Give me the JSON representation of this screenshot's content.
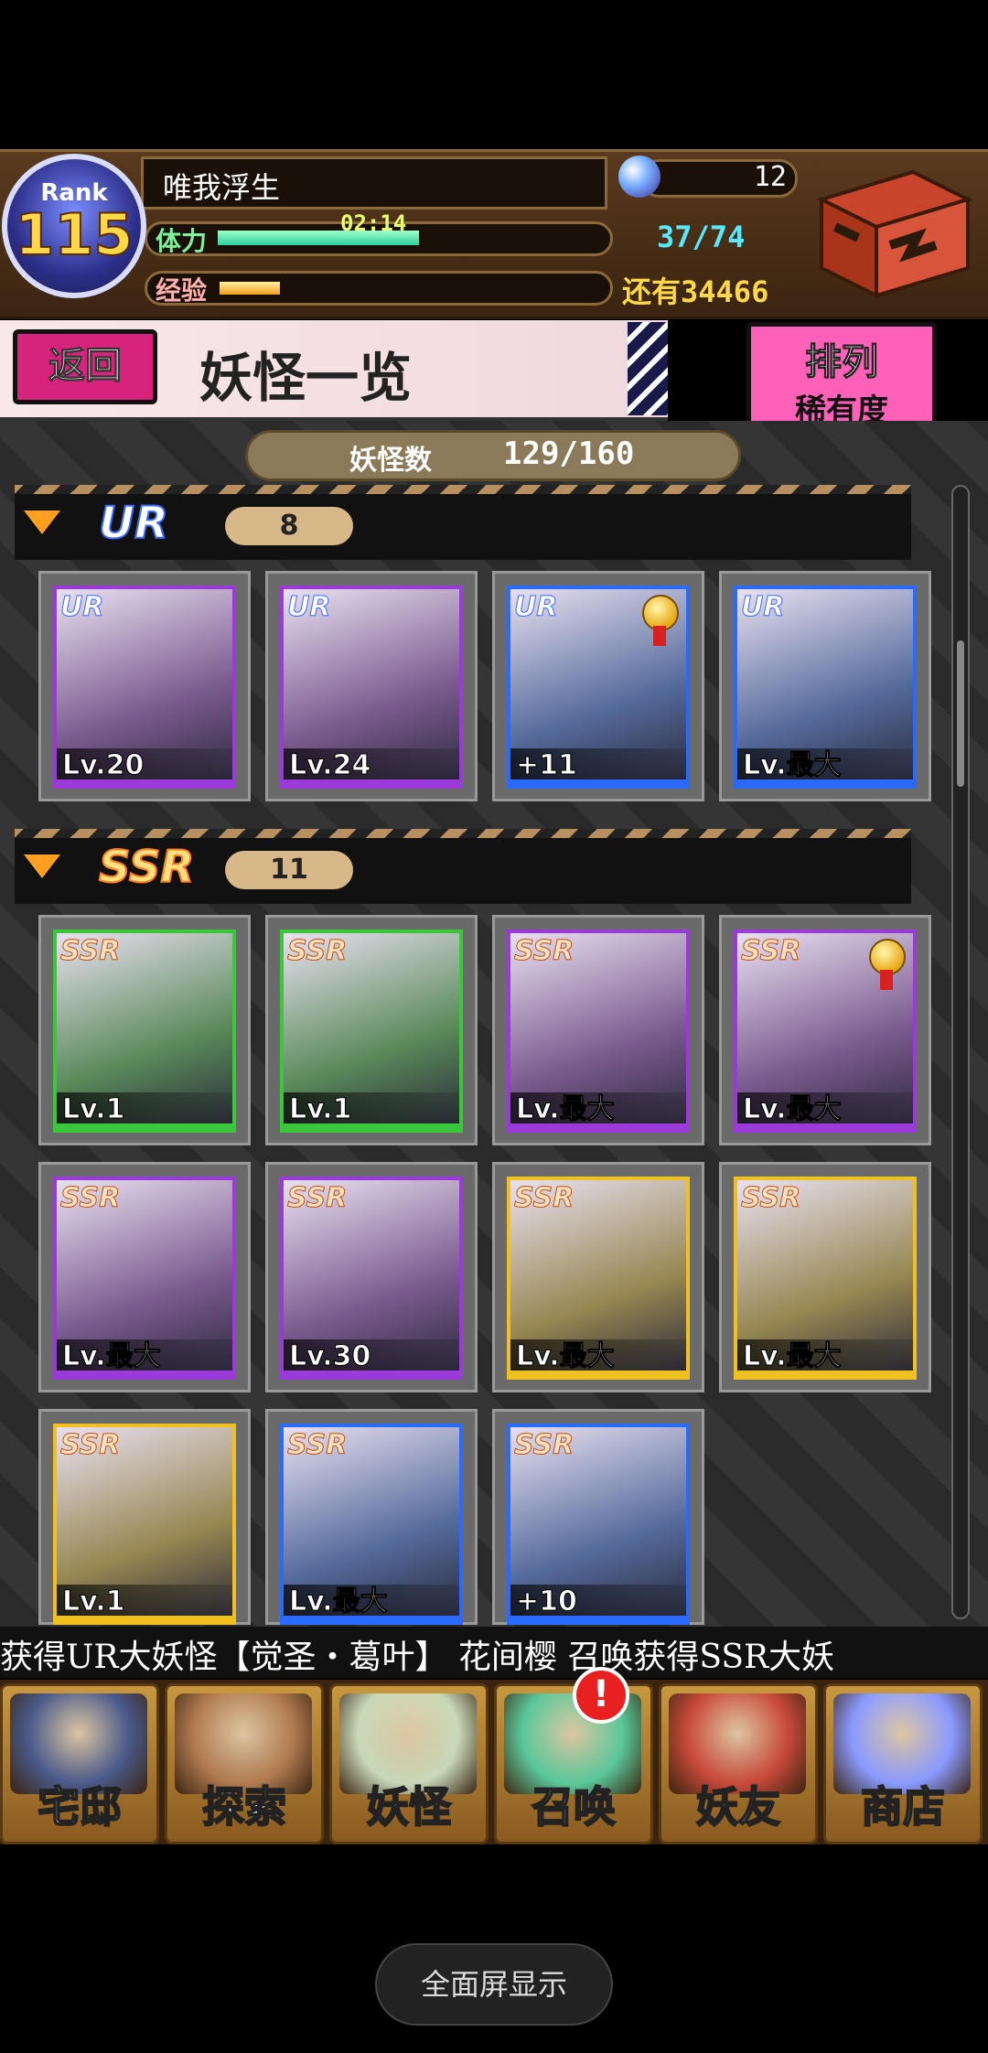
{
  "header": {
    "rank_label": "Rank",
    "rank_value": "115",
    "player_name": "唯我浮生",
    "stamina_label": "体力",
    "stamina_timer": "02:14",
    "stamina_count": "37/74",
    "stamina_fill_fraction": 0.5,
    "exp_label": "经验",
    "exp_fill_fraction": 0.15,
    "exp_remaining": "还有34466",
    "orb_count": "12"
  },
  "title_bar": {
    "back_label": "返回",
    "page_title": "妖怪一览",
    "sort_label": "排列",
    "sort_value": "稀有度"
  },
  "collection": {
    "count_label": "妖怪数",
    "count_value": "129/160"
  },
  "sections": [
    {
      "rarity": "UR",
      "count": "8",
      "cards": [
        {
          "level": "Lv.20",
          "color": "#9b3ad8"
        },
        {
          "level": "Lv.24",
          "color": "#9b3ad8"
        },
        {
          "level": "+11",
          "color": "#2a6aff",
          "medal": true
        },
        {
          "level": "Lv.最大",
          "color": "#2a6aff"
        }
      ]
    },
    {
      "rarity": "SSR",
      "count": "11",
      "cards": [
        {
          "level": "Lv.1",
          "color": "#3ac83a"
        },
        {
          "level": "Lv.1",
          "color": "#3ac83a"
        },
        {
          "level": "Lv.最大",
          "color": "#9b3ad8"
        },
        {
          "level": "Lv.最大",
          "color": "#9b3ad8",
          "medal": true
        },
        {
          "level": "Lv.最大",
          "color": "#9b3ad8"
        },
        {
          "level": "Lv.30",
          "color": "#9b3ad8"
        },
        {
          "level": "Lv.最大",
          "color": "#f0c020"
        },
        {
          "level": "Lv.最大",
          "color": "#f0c020"
        },
        {
          "level": "Lv.1",
          "color": "#f0c020"
        },
        {
          "level": "Lv.最大",
          "color": "#2a6aff"
        },
        {
          "level": "+10",
          "color": "#2a6aff"
        }
      ]
    }
  ],
  "ticker": "获得UR大妖怪【觉圣・葛叶】    花间樱 召唤获得SSR大妖",
  "nav": [
    {
      "label": "宅邸",
      "icon": "house-icon",
      "color": "#4a5a8a"
    },
    {
      "label": "探索",
      "icon": "magnifier-icon",
      "color": "#b07a50"
    },
    {
      "label": "妖怪",
      "icon": "scroll-icon",
      "color": "#c8d8b8"
    },
    {
      "label": "召唤",
      "icon": "pentagram-icon",
      "color": "#5ac89a"
    },
    {
      "label": "妖友",
      "icon": "fox-girl-icon",
      "color": "#c84a3a"
    },
    {
      "label": "商店",
      "icon": "crystal-orb-icon",
      "color": "#8a9aff"
    }
  ],
  "summon_alert": "!",
  "fullscreen_label": "全面屏显示"
}
